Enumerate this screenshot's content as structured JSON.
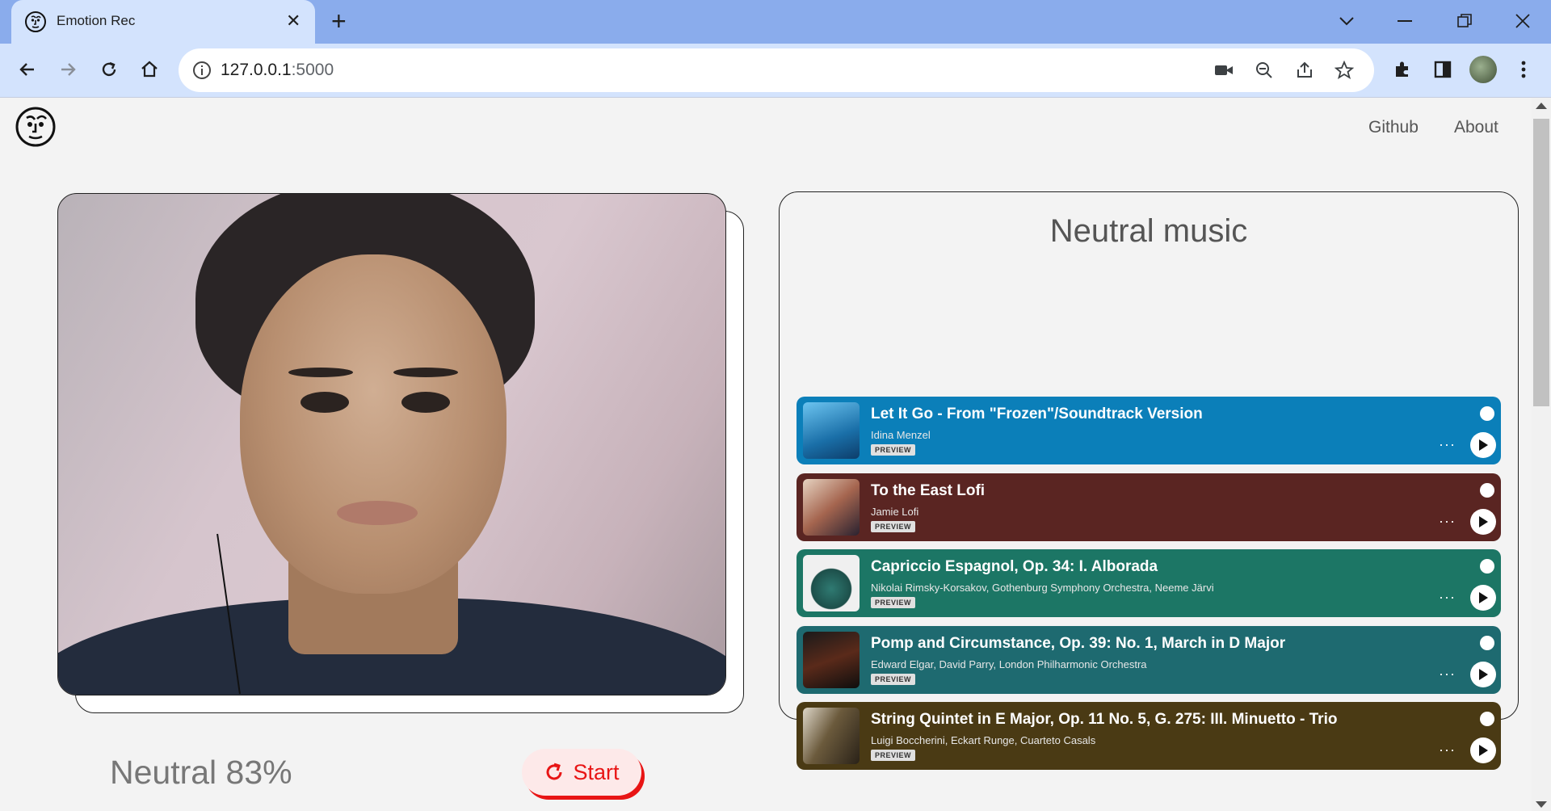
{
  "browser": {
    "tab_title": "Emotion Rec",
    "url_host": "127.0.0.1",
    "url_port": ":5000"
  },
  "nav": {
    "links": [
      "Github",
      "About"
    ]
  },
  "emotion": {
    "result": "Neutral 83%"
  },
  "start_button": {
    "label": "Start"
  },
  "music": {
    "title": "Neutral music",
    "preview_label": "PREVIEW",
    "tracks": [
      {
        "title": "Let It Go - From \"Frozen\"/Soundtrack Version",
        "artist": "Idina Menzel",
        "color": "#0b7fb9"
      },
      {
        "title": "To the East Lofi",
        "artist": "Jamie Lofi",
        "color": "#5a2522"
      },
      {
        "title": "Capriccio Espagnol, Op. 34: I. Alborada",
        "artist": "Nikolai Rimsky-Korsakov, Gothenburg Symphony Orchestra, Neeme Järvi",
        "color": "#1c7665"
      },
      {
        "title": "Pomp and Circumstance, Op. 39: No. 1, March in D Major",
        "artist": "Edward Elgar, David Parry, London Philharmonic Orchestra",
        "color": "#1e6a70"
      },
      {
        "title": "String Quintet in E Major, Op. 11 No. 5, G. 275: III. Minuetto - Trio",
        "artist": "Luigi Boccherini, Eckart Runge, Cuarteto Casals",
        "color": "#4a3a14"
      }
    ]
  }
}
